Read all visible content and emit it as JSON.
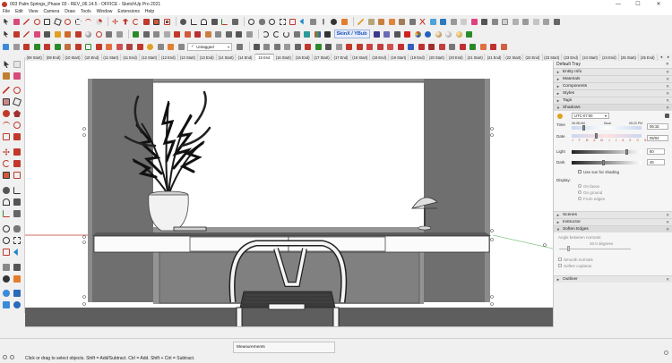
{
  "window": {
    "title": "003 Palm Springs_Phase 03 - REV_06.14.5 - OFFICE - SketchUp Pro 2021",
    "min_glyph": "—",
    "max_glyph": "☐",
    "close_glyph": "✕"
  },
  "menu": [
    "File",
    "Edit",
    "View",
    "Camera",
    "Draw",
    "Tools",
    "Window",
    "Extensions",
    "Help"
  ],
  "toolbar": {
    "layer_value": "Untagged",
    "layer_check": "✓",
    "dropdown_glyph": "▾",
    "skin_badge": "SkinX / YBub"
  },
  "scenes": {
    "tabs": [
      "(09 Start)",
      "(09 End)",
      "(10 Start)",
      "(10 End)",
      "(11 Start)",
      "(11 End)",
      "(12 Start)",
      "(12 End)",
      "(13 Start)",
      "(13 End)",
      "(14 Start)",
      "(14 End)",
      "15 End",
      "(16 Start)",
      "(16 End)",
      "(17 Start)",
      "(17 End)",
      "(18 Start)",
      "(18 End)",
      "(19 Start)",
      "(19 End)",
      "(20 Start)",
      "(20 End)",
      "(21 Start)",
      "(21 End)",
      "(22 Start)",
      "(22 End)",
      "(23 Start)",
      "(23 End)",
      "(24 Start)",
      "(24 End)",
      "(25 Start)",
      "(25 End)"
    ],
    "active_index": 12,
    "prev_glyph": "◂",
    "next_glyph": "▸"
  },
  "tray": {
    "title": "Default Tray",
    "sections_top": [
      "Entity Info",
      "Materials",
      "Components",
      "Styles",
      "Tags"
    ],
    "shadows": {
      "label": "Shadows",
      "timezone": "UTC-07:00",
      "time_label": "Time",
      "time_start": "06:38 AM",
      "time_noon": "Noon",
      "time_end": "05:23 PM",
      "time_value": "06:15",
      "date_label": "Date",
      "months": "J F M A M J J A S O N D",
      "date_value": "05/04",
      "light_label": "Light",
      "light_value": "80",
      "dark_label": "Dark",
      "dark_value": "45",
      "use_sun": "Use sun for shading",
      "display_label": "Display:",
      "on_faces": "On faces",
      "on_ground": "On ground",
      "from_edges": "From edges"
    },
    "sections_mid": [
      "Scenes",
      "Instructor"
    ],
    "soften": {
      "label": "Soften Edges",
      "angle_label": "Angle between normals:",
      "angle_value": "20.0  degrees",
      "smooth": "Smooth normals",
      "coplanar": "Soften coplanar"
    },
    "outliner": "Outliner",
    "collapsed_glyph": "►",
    "expanded_glyph": "▼",
    "close_glyph": "✕"
  },
  "status": {
    "message": "Click or drag to select objects. Shift = Add/Subtract. Ctrl = Add. Shift + Ctrl = Subtract.",
    "measurements_label": "Measurements"
  }
}
